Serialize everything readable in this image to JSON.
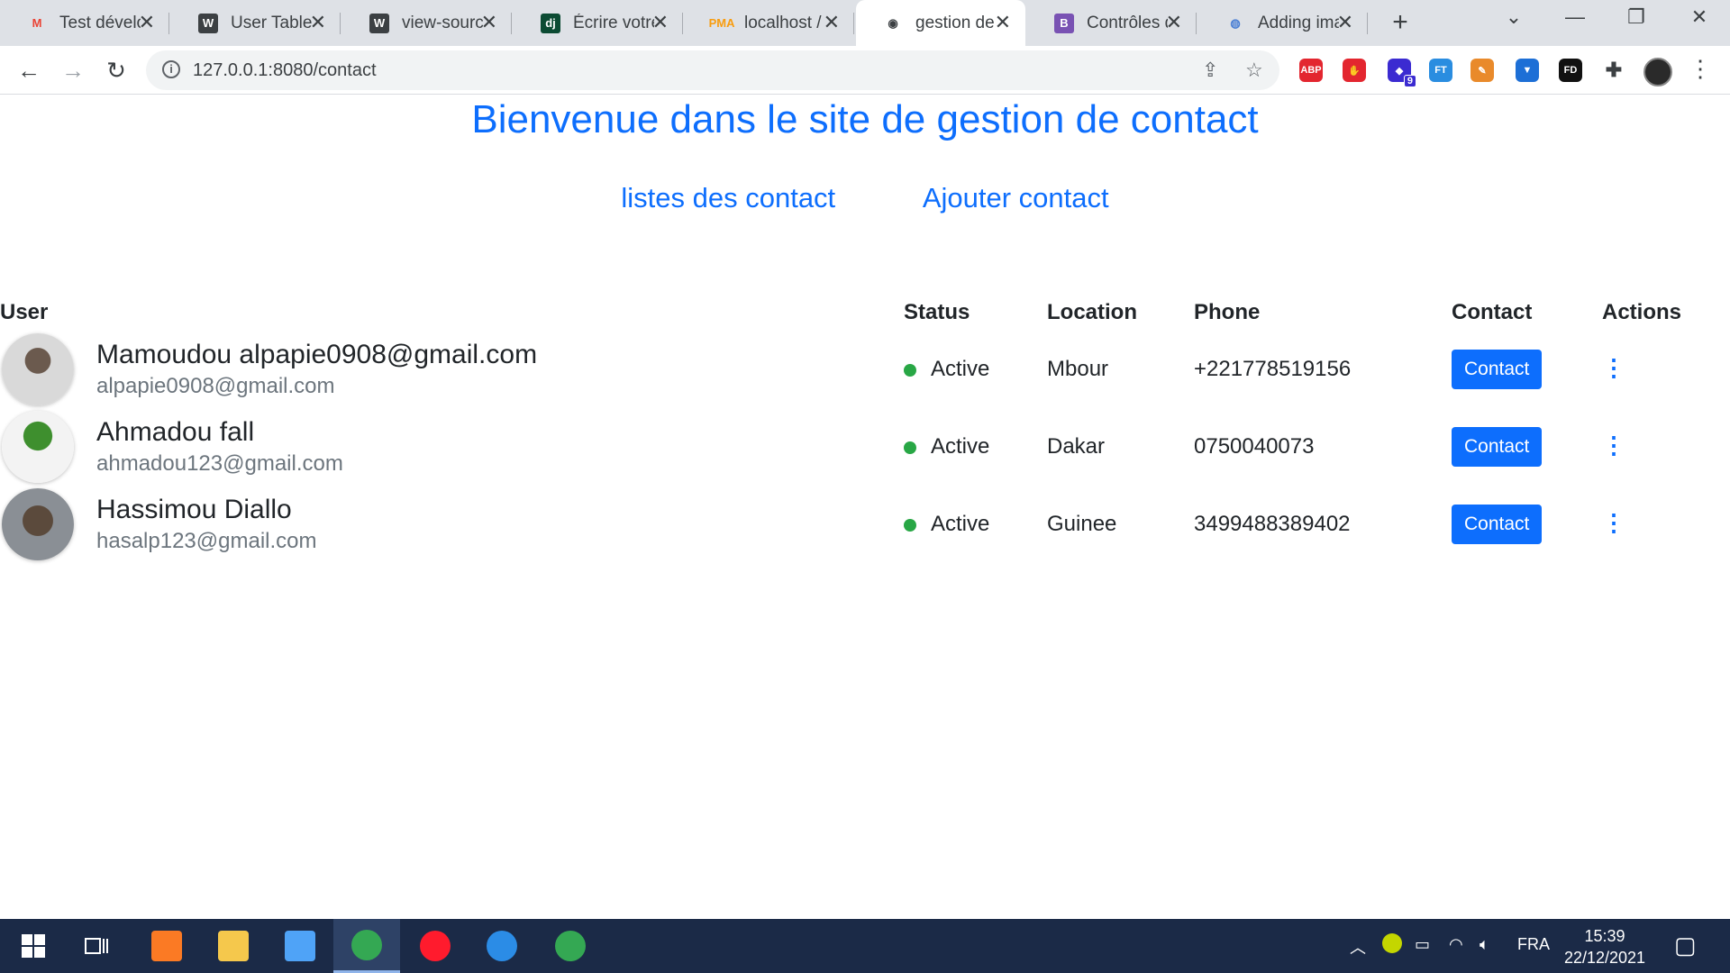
{
  "browser": {
    "tabs": [
      {
        "title": "Test dévelop",
        "icon": "gmail-icon",
        "icon_text": "M",
        "icon_color": "#ea4335",
        "icon_bg": "transparent"
      },
      {
        "title": "User Table U",
        "icon": "wordpress-icon",
        "icon_text": "W",
        "icon_color": "#ffffff",
        "icon_bg": "#3c4043"
      },
      {
        "title": "view-source",
        "icon": "wordpress-icon",
        "icon_text": "W",
        "icon_color": "#ffffff",
        "icon_bg": "#3c4043"
      },
      {
        "title": "Écrire votre",
        "icon": "django-icon",
        "icon_text": "dj",
        "icon_color": "#ffffff",
        "icon_bg": "#0c4b33"
      },
      {
        "title": "localhost /",
        "icon": "phpmyadmin-icon",
        "icon_text": "PMA",
        "icon_color": "#f89c0e",
        "icon_bg": "transparent"
      },
      {
        "title": "gestion de",
        "icon": "globe-icon",
        "icon_text": "◉",
        "icon_color": "#3c4043",
        "icon_bg": "transparent",
        "active": true
      },
      {
        "title": "Contrôles d",
        "icon": "bootstrap-icon",
        "icon_text": "B",
        "icon_color": "#ffffff",
        "icon_bg": "#7952b3"
      },
      {
        "title": "Adding ima",
        "icon": "site-icon",
        "icon_text": "◍",
        "icon_color": "#4a7fd4",
        "icon_bg": "transparent"
      }
    ],
    "url": "127.0.0.1:8080/contact",
    "extensions": [
      {
        "name": "adblock-icon",
        "text": "ABP",
        "color": "#e3262f"
      },
      {
        "name": "ublock-icon",
        "text": "✋",
        "color": "#e3262f"
      },
      {
        "name": "tasks-extension-icon",
        "text": "◆",
        "color": "#3b2bd1",
        "badge": "9"
      },
      {
        "name": "ft-extension-icon",
        "text": "FT",
        "color": "#2a8de0"
      },
      {
        "name": "colorzilla-icon",
        "text": "✎",
        "color": "#e98a2b"
      },
      {
        "name": "vpn-shield-icon",
        "text": "▼",
        "color": "#1d6fd6"
      },
      {
        "name": "fd-extension-icon",
        "text": "FD",
        "color": "#111111"
      }
    ]
  },
  "page": {
    "title": "Bienvenue dans le site de gestion de contact",
    "nav": {
      "list_label": "listes des contact",
      "add_label": "Ajouter contact"
    },
    "table": {
      "headers": {
        "user": "User",
        "status": "Status",
        "location": "Location",
        "phone": "Phone",
        "contact": "Contact",
        "actions": "Actions"
      },
      "rows": [
        {
          "name": "Mamoudou alpapie0908@gmail.com",
          "email": "alpapie0908@gmail.com",
          "status": "Active",
          "location": "Mbour",
          "phone": "+221778519156",
          "contact_label": "Contact"
        },
        {
          "name": "Ahmadou fall",
          "email": "ahmadou123@gmail.com",
          "status": "Active",
          "location": "Dakar",
          "phone": "0750040073",
          "contact_label": "Contact"
        },
        {
          "name": "Hassimou Diallo",
          "email": "hasalp123@gmail.com",
          "status": "Active",
          "location": "Guinee",
          "phone": "3499488389402",
          "contact_label": "Contact"
        }
      ]
    }
  },
  "taskbar": {
    "apps": [
      {
        "name": "xampp-icon",
        "color": "#fb7a24"
      },
      {
        "name": "file-explorer-icon",
        "color": "#f5c84c"
      },
      {
        "name": "mail-icon",
        "color": "#4fa3f7"
      },
      {
        "name": "chrome-icon",
        "color": "#34a853",
        "active": true
      },
      {
        "name": "opera-icon",
        "color": "#ff1b2d"
      },
      {
        "name": "vscode-icon",
        "color": "#2b8ce6"
      },
      {
        "name": "chrome-profile-icon",
        "color": "#34a853"
      }
    ],
    "language": "FRA",
    "time": "15:39",
    "date": "22/12/2021"
  }
}
